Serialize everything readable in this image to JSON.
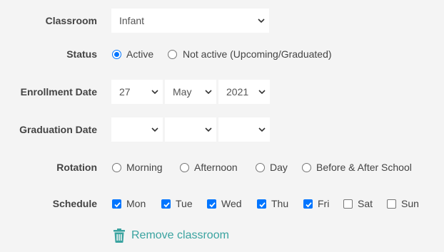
{
  "classroom": {
    "label": "Classroom",
    "value": "Infant"
  },
  "status": {
    "label": "Status",
    "options": [
      {
        "label": "Active",
        "checked": true
      },
      {
        "label": "Not active (Upcoming/Graduated)",
        "checked": false
      }
    ]
  },
  "enrollment": {
    "label": "Enrollment Date",
    "day": "27",
    "month": "May",
    "year": "2021"
  },
  "graduation": {
    "label": "Graduation Date",
    "day": "",
    "month": "",
    "year": ""
  },
  "rotation": {
    "label": "Rotation",
    "options": [
      {
        "label": "Morning",
        "checked": false
      },
      {
        "label": "Afternoon",
        "checked": false
      },
      {
        "label": "Day",
        "checked": false
      },
      {
        "label": "Before & After School",
        "checked": false
      }
    ]
  },
  "schedule": {
    "label": "Schedule",
    "days": [
      {
        "label": "Mon",
        "checked": true
      },
      {
        "label": "Tue",
        "checked": true
      },
      {
        "label": "Wed",
        "checked": true
      },
      {
        "label": "Thu",
        "checked": true
      },
      {
        "label": "Fri",
        "checked": true
      },
      {
        "label": "Sat",
        "checked": false
      },
      {
        "label": "Sun",
        "checked": false
      }
    ]
  },
  "remove": {
    "label": "Remove classroom",
    "icon": "trash-icon"
  },
  "colors": {
    "accent": "#0075ff",
    "link": "#3aa3a0"
  }
}
